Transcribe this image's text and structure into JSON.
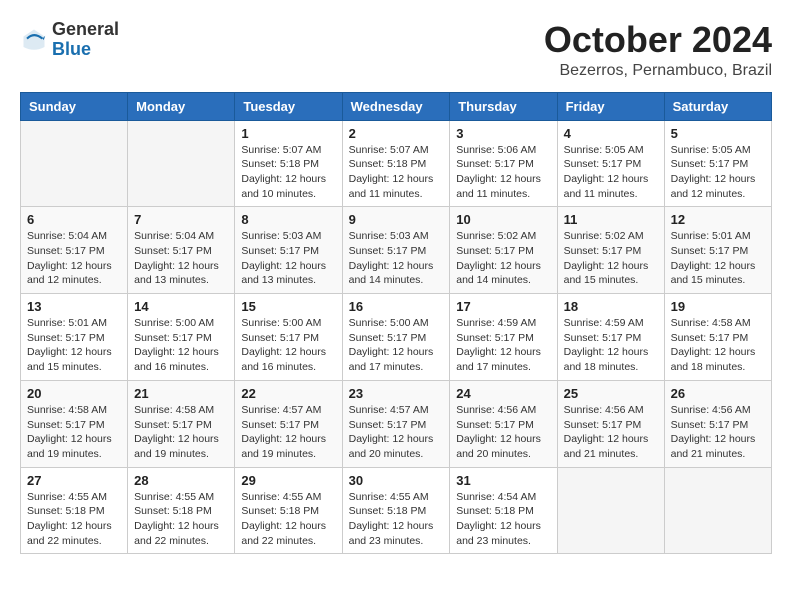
{
  "header": {
    "logo_general": "General",
    "logo_blue": "Blue",
    "month": "October 2024",
    "location": "Bezerros, Pernambuco, Brazil"
  },
  "days_of_week": [
    "Sunday",
    "Monday",
    "Tuesday",
    "Wednesday",
    "Thursday",
    "Friday",
    "Saturday"
  ],
  "weeks": [
    [
      {
        "day": "",
        "info": ""
      },
      {
        "day": "",
        "info": ""
      },
      {
        "day": "1",
        "info": "Sunrise: 5:07 AM\nSunset: 5:18 PM\nDaylight: 12 hours and 10 minutes."
      },
      {
        "day": "2",
        "info": "Sunrise: 5:07 AM\nSunset: 5:18 PM\nDaylight: 12 hours and 11 minutes."
      },
      {
        "day": "3",
        "info": "Sunrise: 5:06 AM\nSunset: 5:17 PM\nDaylight: 12 hours and 11 minutes."
      },
      {
        "day": "4",
        "info": "Sunrise: 5:05 AM\nSunset: 5:17 PM\nDaylight: 12 hours and 11 minutes."
      },
      {
        "day": "5",
        "info": "Sunrise: 5:05 AM\nSunset: 5:17 PM\nDaylight: 12 hours and 12 minutes."
      }
    ],
    [
      {
        "day": "6",
        "info": "Sunrise: 5:04 AM\nSunset: 5:17 PM\nDaylight: 12 hours and 12 minutes."
      },
      {
        "day": "7",
        "info": "Sunrise: 5:04 AM\nSunset: 5:17 PM\nDaylight: 12 hours and 13 minutes."
      },
      {
        "day": "8",
        "info": "Sunrise: 5:03 AM\nSunset: 5:17 PM\nDaylight: 12 hours and 13 minutes."
      },
      {
        "day": "9",
        "info": "Sunrise: 5:03 AM\nSunset: 5:17 PM\nDaylight: 12 hours and 14 minutes."
      },
      {
        "day": "10",
        "info": "Sunrise: 5:02 AM\nSunset: 5:17 PM\nDaylight: 12 hours and 14 minutes."
      },
      {
        "day": "11",
        "info": "Sunrise: 5:02 AM\nSunset: 5:17 PM\nDaylight: 12 hours and 15 minutes."
      },
      {
        "day": "12",
        "info": "Sunrise: 5:01 AM\nSunset: 5:17 PM\nDaylight: 12 hours and 15 minutes."
      }
    ],
    [
      {
        "day": "13",
        "info": "Sunrise: 5:01 AM\nSunset: 5:17 PM\nDaylight: 12 hours and 15 minutes."
      },
      {
        "day": "14",
        "info": "Sunrise: 5:00 AM\nSunset: 5:17 PM\nDaylight: 12 hours and 16 minutes."
      },
      {
        "day": "15",
        "info": "Sunrise: 5:00 AM\nSunset: 5:17 PM\nDaylight: 12 hours and 16 minutes."
      },
      {
        "day": "16",
        "info": "Sunrise: 5:00 AM\nSunset: 5:17 PM\nDaylight: 12 hours and 17 minutes."
      },
      {
        "day": "17",
        "info": "Sunrise: 4:59 AM\nSunset: 5:17 PM\nDaylight: 12 hours and 17 minutes."
      },
      {
        "day": "18",
        "info": "Sunrise: 4:59 AM\nSunset: 5:17 PM\nDaylight: 12 hours and 18 minutes."
      },
      {
        "day": "19",
        "info": "Sunrise: 4:58 AM\nSunset: 5:17 PM\nDaylight: 12 hours and 18 minutes."
      }
    ],
    [
      {
        "day": "20",
        "info": "Sunrise: 4:58 AM\nSunset: 5:17 PM\nDaylight: 12 hours and 19 minutes."
      },
      {
        "day": "21",
        "info": "Sunrise: 4:58 AM\nSunset: 5:17 PM\nDaylight: 12 hours and 19 minutes."
      },
      {
        "day": "22",
        "info": "Sunrise: 4:57 AM\nSunset: 5:17 PM\nDaylight: 12 hours and 19 minutes."
      },
      {
        "day": "23",
        "info": "Sunrise: 4:57 AM\nSunset: 5:17 PM\nDaylight: 12 hours and 20 minutes."
      },
      {
        "day": "24",
        "info": "Sunrise: 4:56 AM\nSunset: 5:17 PM\nDaylight: 12 hours and 20 minutes."
      },
      {
        "day": "25",
        "info": "Sunrise: 4:56 AM\nSunset: 5:17 PM\nDaylight: 12 hours and 21 minutes."
      },
      {
        "day": "26",
        "info": "Sunrise: 4:56 AM\nSunset: 5:17 PM\nDaylight: 12 hours and 21 minutes."
      }
    ],
    [
      {
        "day": "27",
        "info": "Sunrise: 4:55 AM\nSunset: 5:18 PM\nDaylight: 12 hours and 22 minutes."
      },
      {
        "day": "28",
        "info": "Sunrise: 4:55 AM\nSunset: 5:18 PM\nDaylight: 12 hours and 22 minutes."
      },
      {
        "day": "29",
        "info": "Sunrise: 4:55 AM\nSunset: 5:18 PM\nDaylight: 12 hours and 22 minutes."
      },
      {
        "day": "30",
        "info": "Sunrise: 4:55 AM\nSunset: 5:18 PM\nDaylight: 12 hours and 23 minutes."
      },
      {
        "day": "31",
        "info": "Sunrise: 4:54 AM\nSunset: 5:18 PM\nDaylight: 12 hours and 23 minutes."
      },
      {
        "day": "",
        "info": ""
      },
      {
        "day": "",
        "info": ""
      }
    ]
  ]
}
